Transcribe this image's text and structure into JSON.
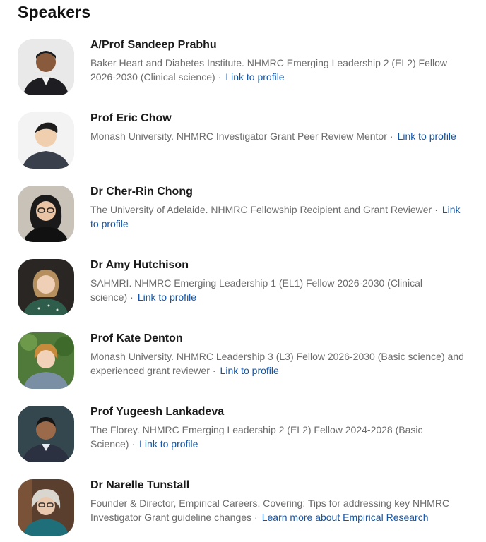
{
  "heading": "Speakers",
  "separator": "·",
  "speakers": [
    {
      "name": "A/Prof Sandeep Prabhu",
      "description": "Baker Heart and Diabetes Institute. NHMRC Emerging Leadership 2 (EL2) Fellow 2026-2030 (Clinical science)",
      "link": "Link to profile"
    },
    {
      "name": "Prof Eric Chow",
      "description": "Monash University. NHMRC Investigator Grant Peer Review Mentor",
      "link": "Link to profile"
    },
    {
      "name": "Dr Cher-Rin Chong",
      "description": "The University of Adelaide. NHMRC Fellowship Recipient and Grant Reviewer",
      "link": "Link to profile"
    },
    {
      "name": "Dr Amy Hutchison",
      "description": "SAHMRI. NHMRC Emerging Leadership 1 (EL1) Fellow 2026-2030 (Clinical science)",
      "link": "Link to profile"
    },
    {
      "name": "Prof Kate Denton",
      "description": "Monash University. NHMRC Leadership 3 (L3) Fellow 2026-2030 (Basic science) and experienced grant reviewer",
      "link": "Link to profile"
    },
    {
      "name": "Prof Yugeesh Lankadeva",
      "description": "The Florey. NHMRC Emerging Leadership 2 (EL2) Fellow 2024-2028 (Basic Science)",
      "link": "Link to profile"
    },
    {
      "name": "Dr Narelle Tunstall",
      "description": "Founder & Director, Empirical Careers. Covering: Tips for addressing key NHMRC Investigator Grant guideline changes",
      "link": "Learn more about Empirical Research"
    }
  ]
}
